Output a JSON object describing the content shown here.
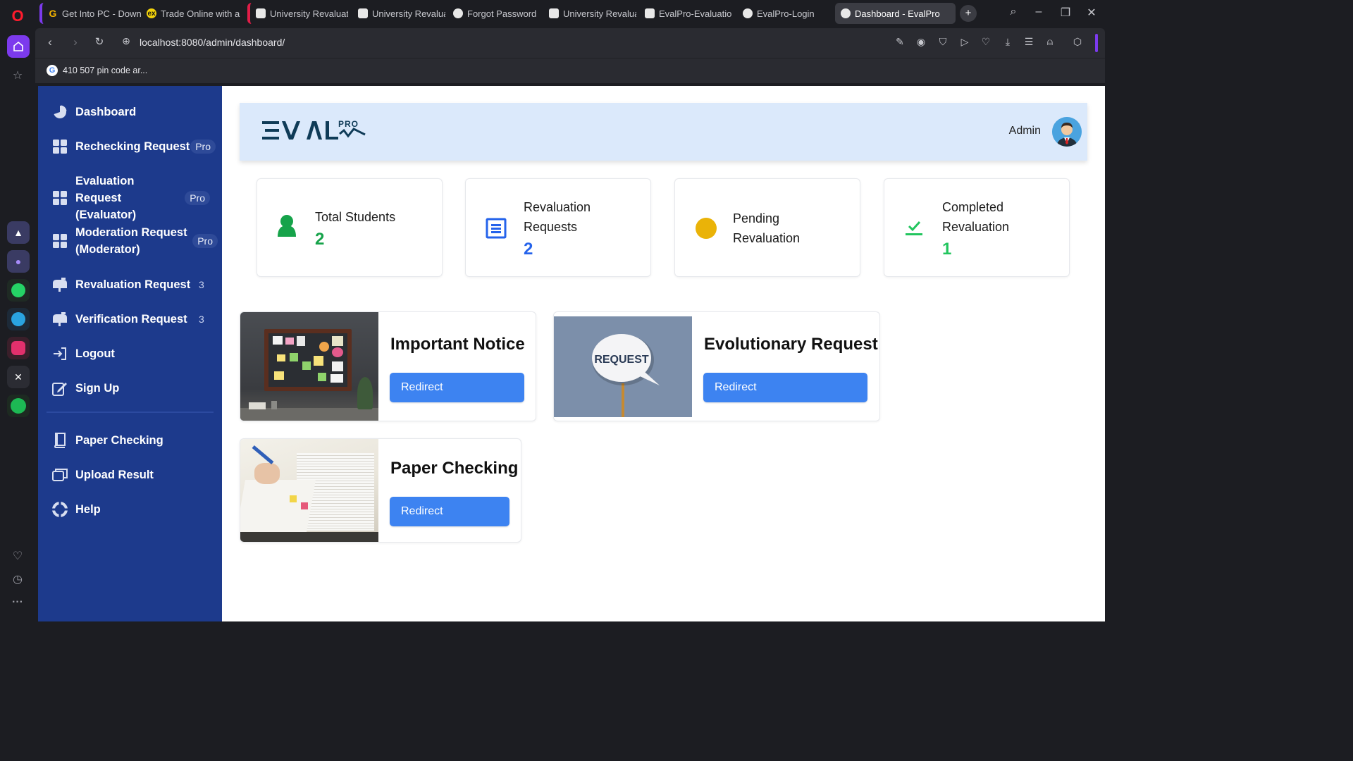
{
  "browser": {
    "tabs": [
      {
        "label": "Get Into PC - Down",
        "fav": "G",
        "color": "#f5b400"
      },
      {
        "label": "Trade Online with a",
        "fav": "ex",
        "color": "#f2d20b"
      },
      {
        "label": "University Revaluat",
        "fav": "",
        "color": "#e8e8e8"
      },
      {
        "label": "University Revaluat",
        "fav": "",
        "color": "#e8e8e8"
      },
      {
        "label": "Forgot Password",
        "fav": "",
        "color": "#e8e8e8"
      },
      {
        "label": "University Revaluat",
        "fav": "",
        "color": "#e8e8e8"
      },
      {
        "label": "EvalPro-Evaluation",
        "fav": "",
        "color": "#e8e8e8"
      },
      {
        "label": "EvalPro-Login",
        "fav": "",
        "color": "#e8e8e8"
      },
      {
        "label": "Dashboard - EvalPro",
        "fav": "",
        "color": "#e8e8e8"
      }
    ],
    "url": "localhost:8080/admin/dashboard/",
    "bookmark": "410 507 pin code ar..."
  },
  "sidebar": {
    "items": [
      {
        "label": "Dashboard",
        "icon": "pie-chart-icon"
      },
      {
        "label": "Rechecking Request",
        "badge": "Pro",
        "icon": "grid-icon"
      },
      {
        "label": "Evaluation Request (Evaluator)",
        "badge": "Pro",
        "icon": "grid-icon"
      },
      {
        "label": "Moderation Request (Moderator)",
        "badge": "Pro",
        "icon": "grid-icon"
      },
      {
        "label": "Revaluation Request",
        "count": "3",
        "icon": "mailbox-icon"
      },
      {
        "label": "Verification Request",
        "count": "3",
        "icon": "mailbox-icon"
      },
      {
        "label": "Logout",
        "icon": "logout-icon"
      },
      {
        "label": "Sign Up",
        "icon": "signup-icon"
      },
      {
        "label": "Paper Checking",
        "icon": "book-icon"
      },
      {
        "label": "Upload Result",
        "icon": "window-icon"
      },
      {
        "label": "Help",
        "icon": "lifebuoy-icon"
      }
    ]
  },
  "header": {
    "logo": "EVAL",
    "logo_sup": "PRO",
    "user": "Admin"
  },
  "stats": [
    {
      "title": "Total Students",
      "value": "2",
      "color": "#16a34a",
      "icon": "user-icon"
    },
    {
      "title": "Revaluation Requests",
      "value": "2",
      "color": "#2563eb",
      "icon": "list-icon"
    },
    {
      "title": "Pending Revaluation",
      "value": "",
      "color": "#eab308",
      "icon": "circle-icon"
    },
    {
      "title": "Completed Revaluation",
      "value": "1",
      "color": "#22c55e",
      "icon": "check-icon"
    }
  ],
  "cards": [
    {
      "title": "Important Notice",
      "button": "Redirect"
    },
    {
      "title": "Evolutionary Request",
      "button": "Redirect",
      "image_text": "REQUEST"
    },
    {
      "title": "Paper Checking",
      "button": "Redirect"
    }
  ],
  "colors": {
    "sidebar": "#1d3a8c",
    "header": "#dbe9fb",
    "button": "#3d83f1"
  }
}
